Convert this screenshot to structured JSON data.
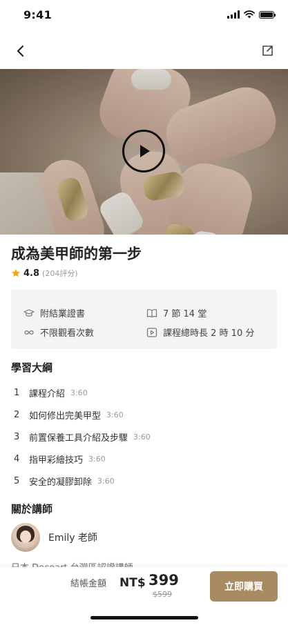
{
  "status_bar": {
    "time": "9:41",
    "icons": [
      "signal-icon",
      "wifi-icon",
      "battery-icon"
    ]
  },
  "nav": {
    "back_icon": "chevron-left-icon",
    "share_icon": "share-icon"
  },
  "course": {
    "title": "成為美甲師的第一步",
    "rating": "4.8",
    "rating_count": "(204評分)"
  },
  "info": {
    "certificate": "附結業證書",
    "sections": "7 節 14 堂",
    "unlimited": "不限觀看次數",
    "duration": "課程總時長 2 時 10 分"
  },
  "outline": {
    "title": "學習大綱",
    "items": [
      {
        "num": "1",
        "label": "課程介紹",
        "duration": "3:60"
      },
      {
        "num": "2",
        "label": "如何修出完美甲型",
        "duration": "3:60"
      },
      {
        "num": "3",
        "label": "前置保養工具介紹及步驟",
        "duration": "3:60"
      },
      {
        "num": "4",
        "label": "指甲彩繪技巧",
        "duration": "3:60"
      },
      {
        "num": "5",
        "label": "安全的凝膠卸除",
        "duration": "3:60"
      }
    ]
  },
  "teacher": {
    "section_title": "關於講師",
    "name": "Emily 老師",
    "bio": "日本 Decoart 台灣區認證講師"
  },
  "checkout": {
    "label": "結帳金額",
    "currency": "NT$",
    "price": "399",
    "original_price": "$599",
    "buy_label": "立即購買"
  },
  "colors": {
    "accent": "#a88a63",
    "star": "#f5a623",
    "panel": "#f4f4f4"
  }
}
